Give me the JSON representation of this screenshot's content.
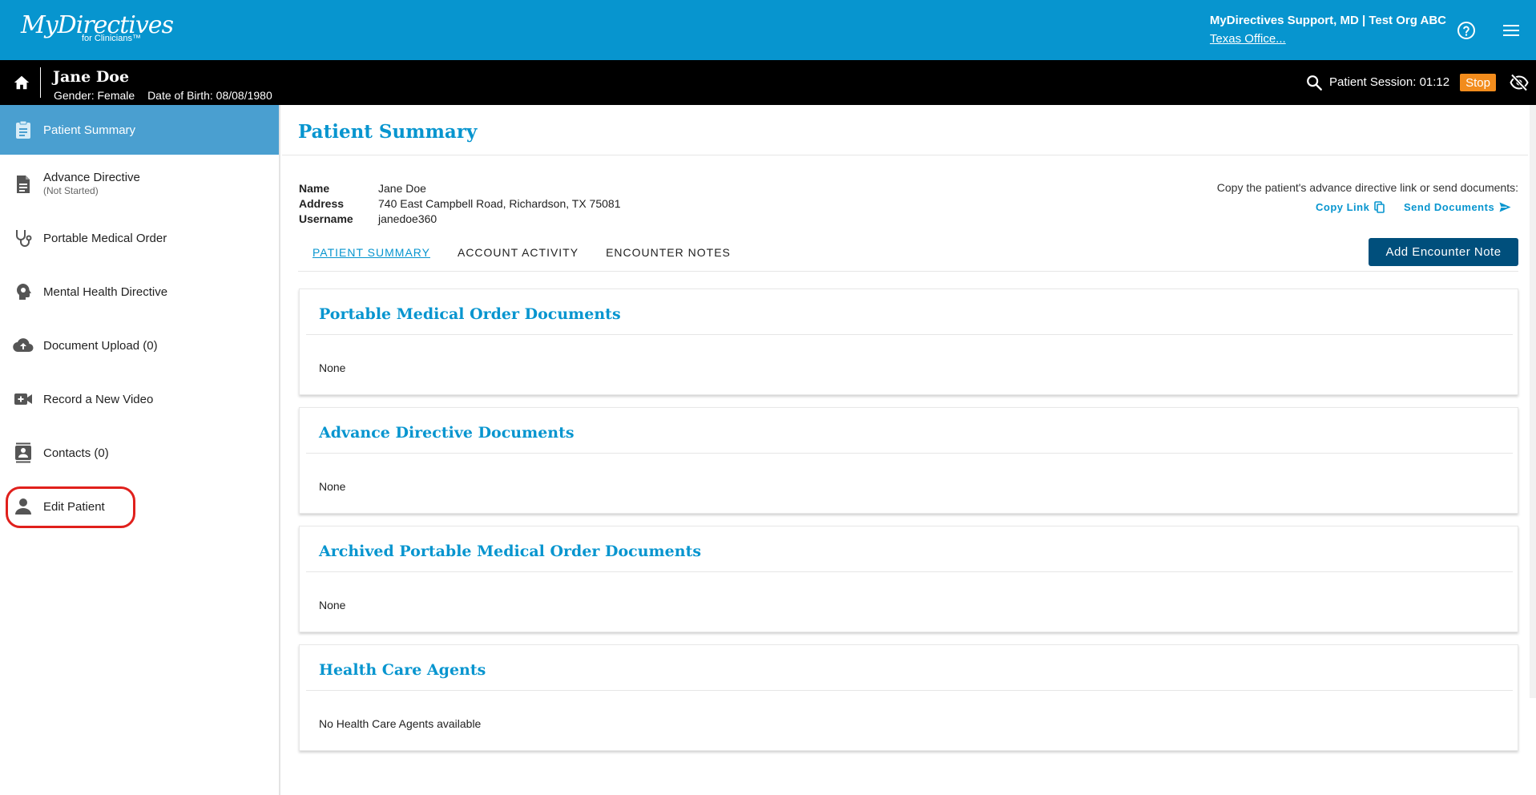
{
  "header": {
    "logo_brand": "MyDirectives",
    "logo_sub": "for Clinicians™",
    "user_name": "MyDirectives Support, MD | Test Org ABC",
    "user_org": "Texas Office..."
  },
  "patient_bar": {
    "name": "Jane Doe",
    "gender": "Gender: Female",
    "dob": "Date of Birth: 08/08/1980",
    "session": "Patient Session: 01:12",
    "stop_label": "Stop"
  },
  "sidebar": {
    "items": [
      {
        "label": "Patient Summary",
        "icon": "clipboard-icon"
      },
      {
        "label": "Advance Directive",
        "sub": "(Not Started)",
        "icon": "document-icon"
      },
      {
        "label": "Portable Medical Order",
        "icon": "stethoscope-icon"
      },
      {
        "label": "Mental Health Directive",
        "icon": "head-icon"
      },
      {
        "label": "Document Upload (0)",
        "icon": "cloud-upload-icon"
      },
      {
        "label": "Record a New Video",
        "icon": "video-icon"
      },
      {
        "label": "Contacts (0)",
        "icon": "contacts-icon"
      },
      {
        "label": "Edit Patient",
        "icon": "person-icon"
      }
    ]
  },
  "main": {
    "title": "Patient Summary",
    "info": {
      "name_label": "Name",
      "address_label": "Address",
      "username_label": "Username",
      "name": "Jane Doe",
      "address": "740 East Campbell Road, Richardson, TX 75081",
      "username": "janedoe360"
    },
    "copy_hint": "Copy the patient's advance directive link or send documents:",
    "copy_link": "Copy Link",
    "send_documents": "Send Documents",
    "tabs": [
      "PATIENT SUMMARY",
      "ACCOUNT ACTIVITY",
      "ENCOUNTER NOTES"
    ],
    "add_note": "Add Encounter Note",
    "cards": [
      {
        "title": "Portable Medical Order Documents",
        "body": "None"
      },
      {
        "title": "Advance Directive Documents",
        "body": "None"
      },
      {
        "title": "Archived Portable Medical Order Documents",
        "body": "None"
      },
      {
        "title": "Health Care Agents",
        "body": "No Health Care Agents available"
      }
    ]
  },
  "colors": {
    "brand_blue": "#0795cf",
    "active_nav": "#4a9fd0",
    "dark_button": "#004f7c",
    "stop_orange": "#f28c1c",
    "highlight_red": "#e0201c"
  }
}
